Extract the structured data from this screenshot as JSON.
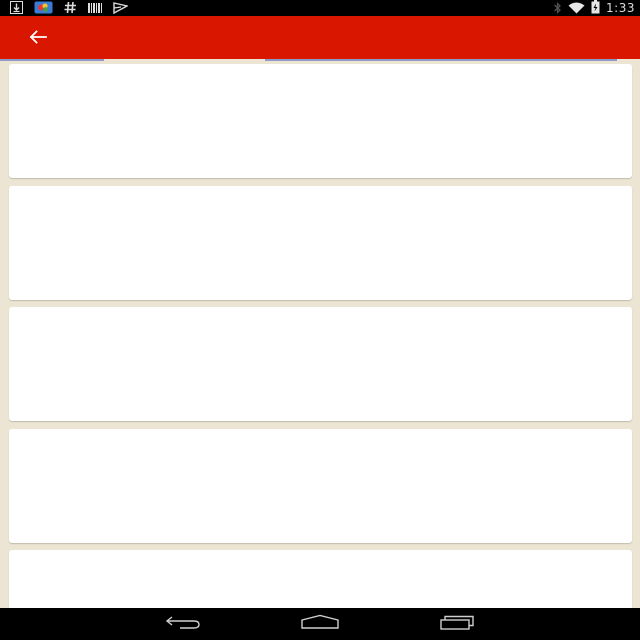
{
  "status_bar": {
    "time": "1:33",
    "left_icons": [
      "download-icon",
      "photos-icon",
      "hashtag-icon",
      "barcode-icon",
      "mail-icon"
    ],
    "right_icons": [
      "bluetooth-icon",
      "wifi-icon",
      "battery-charging-icon"
    ]
  },
  "app_bar": {
    "color": "#d91600",
    "back_icon": "arrow-left-icon"
  },
  "content": {
    "background": "#ece5d3",
    "cards": [
      {
        "content": ""
      },
      {
        "content": ""
      },
      {
        "content": ""
      },
      {
        "content": ""
      },
      {
        "content": ""
      }
    ]
  },
  "nav_bar": {
    "buttons": [
      "back-nav-icon",
      "home-nav-icon",
      "recents-nav-icon"
    ]
  }
}
